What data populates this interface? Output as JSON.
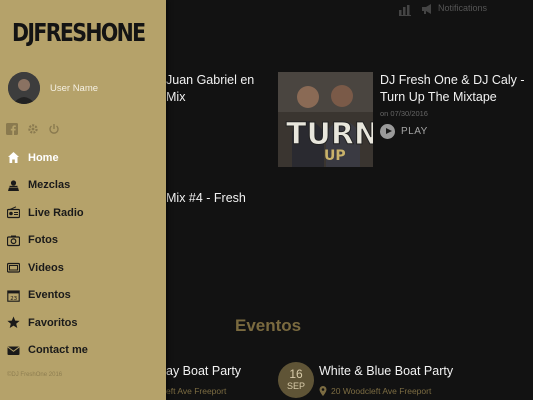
{
  "topbar": {
    "notifications_label": "Notifications",
    "chart_icon": "bar-chart-icon",
    "megaphone_icon": "megaphone-icon"
  },
  "main": {
    "mixtapes": [
      {
        "title": "Juan Gabriel en\nMix"
      },
      {
        "title": "DJ Fresh One & DJ Caly - Turn Up The Mixtape",
        "date": "on 07/30/2016",
        "play_label": "PLAY"
      },
      {
        "title": "Mix #4 - Fresh"
      }
    ],
    "events_heading": "Eventos",
    "events": [
      {
        "title": "ay Boat Party",
        "address": "eft Ave Freeport"
      },
      {
        "day": "16",
        "month": "SEP",
        "title": "White & Blue Boat Party",
        "address": "20 Woodcleft Ave Freeport"
      }
    ]
  },
  "drawer": {
    "logo_text": "DJFRESHONE",
    "user_name": "User Name",
    "quick_icons": [
      "facebook-icon",
      "settings-icon",
      "power-icon"
    ],
    "nav": [
      {
        "label": "Home",
        "icon": "home-icon",
        "active": true
      },
      {
        "label": "Mezclas",
        "icon": "dj-icon",
        "active": false
      },
      {
        "label": "Live Radio",
        "icon": "radio-icon",
        "active": false
      },
      {
        "label": "Fotos",
        "icon": "camera-icon",
        "active": false
      },
      {
        "label": "Videos",
        "icon": "video-icon",
        "active": false
      },
      {
        "label": "Eventos",
        "icon": "calendar-icon",
        "active": false
      },
      {
        "label": "Favoritos",
        "icon": "star-icon",
        "active": false
      },
      {
        "label": "Contact me",
        "icon": "mail-icon",
        "active": false
      }
    ],
    "copyright": "©DJ FreshOne 2016"
  },
  "colors": {
    "drawer_bg": "#b5a26a",
    "background": "#121212",
    "accent": "#7a6a3f",
    "active_nav": "#ffffff"
  }
}
